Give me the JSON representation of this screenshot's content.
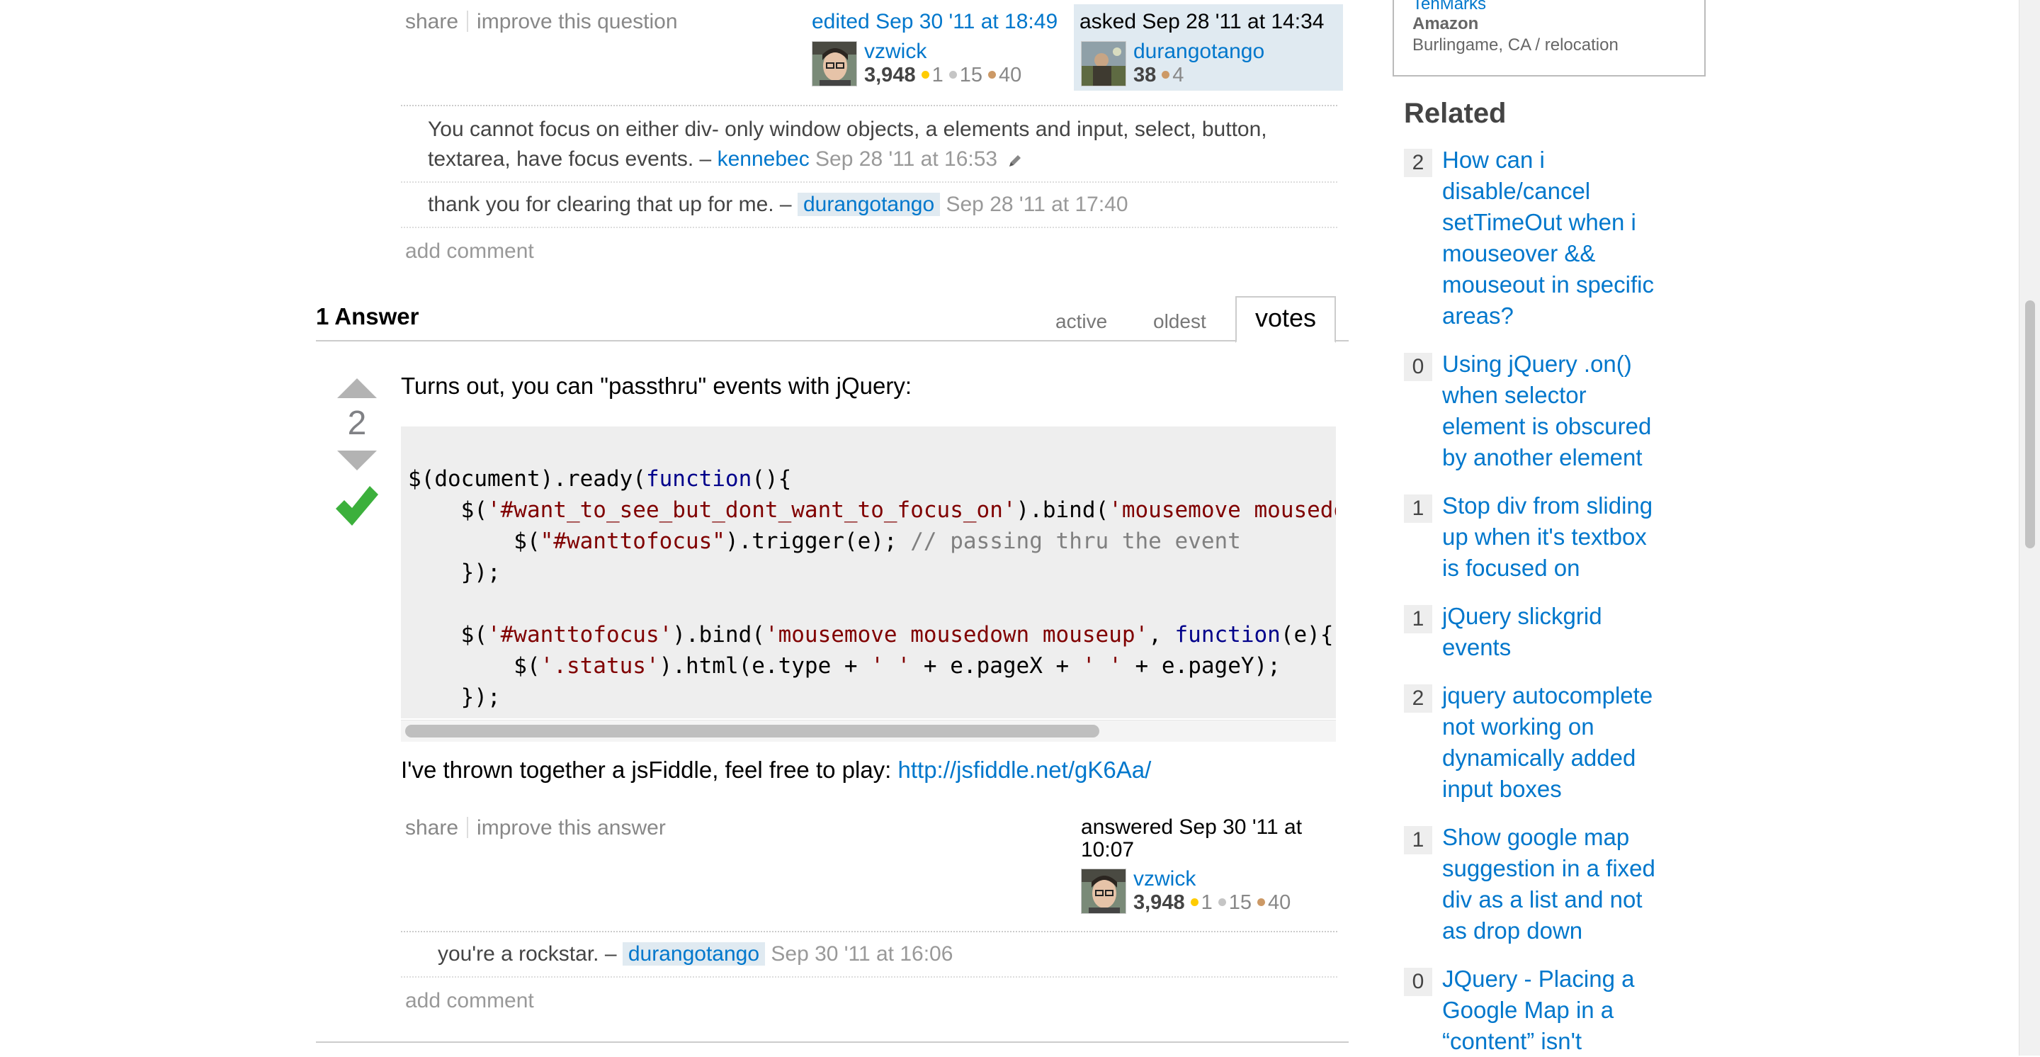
{
  "question": {
    "menu": {
      "share": "share",
      "improve": "improve this question"
    },
    "edited": {
      "action": "edited Sep 30 '11 at 18:49",
      "user": "vzwick",
      "rep": "3,948",
      "gold": "1",
      "silver": "15",
      "bronze": "40"
    },
    "asked": {
      "action": "asked Sep 28 '11 at 14:34",
      "user": "durangotango",
      "rep": "38",
      "bronze": "4"
    },
    "comments": [
      {
        "text_line1": "You cannot focus on either div- only window objects, a elements and input, select, button,",
        "text_line2": "textarea, have focus events. –",
        "user": "kennebec",
        "date": "Sep 28 '11 at 16:53"
      },
      {
        "text": "thank you for clearing that up for me. –",
        "user": "durangotango",
        "date": "Sep 28 '11 at 17:40"
      }
    ],
    "add_comment": "add comment"
  },
  "answers_header": {
    "title": "1 Answer",
    "tabs": [
      "active",
      "oldest",
      "votes"
    ]
  },
  "answer": {
    "votes": "2",
    "intro": "Turns out, you can \"passthru\" events with jQuery:",
    "code": {
      "l1a": "$(document).ready(",
      "l1b": "function",
      "l1c": "(){",
      "l2a": "    $(",
      "l2b": "'#want_to_see_but_dont_want_to_focus_on'",
      "l2c": ").bind(",
      "l2d": "'mousemove mousedown",
      "l3a": "        $(",
      "l3b": "\"#wanttofocus\"",
      "l3c": ").trigger(e); ",
      "l3d": "// passing thru the event",
      "l4": "    });",
      "l6a": "    $(",
      "l6b": "'#wanttofocus'",
      "l6c": ").bind(",
      "l6d": "'mousemove mousedown mouseup'",
      "l6e": ", ",
      "l6f": "function",
      "l6g": "(e){",
      "l7a": "        $(",
      "l7b": "'.status'",
      "l7c": ").html(e.type + ",
      "l7d": "' '",
      "l7e": " + e.pageX + ",
      "l7f": "' '",
      "l7g": " + e.pageY);",
      "l8": "    });",
      "l9": "});"
    },
    "fiddle_text": "I've thrown together a jsFiddle, feel free to play:",
    "fiddle_link": "http://jsfiddle.net/gK6Aa/",
    "menu": {
      "share": "share",
      "improve": "improve this answer"
    },
    "answered": {
      "action_line1": "answered Sep 30 '11 at",
      "action_line2": "10:07",
      "user": "vzwick",
      "rep": "3,948",
      "gold": "1",
      "silver": "15",
      "bronze": "40"
    },
    "comments": [
      {
        "text": "you're a rockstar. –",
        "user": "durangotango",
        "date": "Sep 30 '11 at 16:06"
      }
    ],
    "add_comment": "add comment"
  },
  "sidebar": {
    "job": {
      "company_link": "TenMarks",
      "company": "Amazon",
      "location": "Burlingame, CA / relocation"
    },
    "related_title": "Related",
    "related": [
      {
        "count": "2",
        "lines": [
          "How can i",
          "disable/cancel",
          "setTimeOut when i",
          "mouseover &&",
          "mouseout in specific",
          "areas?"
        ]
      },
      {
        "count": "0",
        "lines": [
          "Using jQuery .on()",
          "when selector",
          "element is obscured",
          "by another element"
        ]
      },
      {
        "count": "1",
        "lines": [
          "Stop div from sliding",
          "up when it's textbox",
          "is focused on"
        ]
      },
      {
        "count": "1",
        "lines": [
          "jQuery slickgrid",
          "events"
        ]
      },
      {
        "count": "2",
        "lines": [
          "jquery autocomplete",
          "not working on",
          "dynamically added",
          "input boxes"
        ]
      },
      {
        "count": "1",
        "lines": [
          "Show google map",
          "suggestion in a fixed",
          "div as a list and not",
          "as drop down"
        ]
      },
      {
        "count": "0",
        "lines": [
          "JQuery - Placing a",
          "Google Map in a",
          "“content” isn't"
        ]
      }
    ]
  },
  "colors": {
    "link": "#0077cc",
    "accepted": "#3cb03c",
    "op_highlight": "#e0eaf1"
  }
}
